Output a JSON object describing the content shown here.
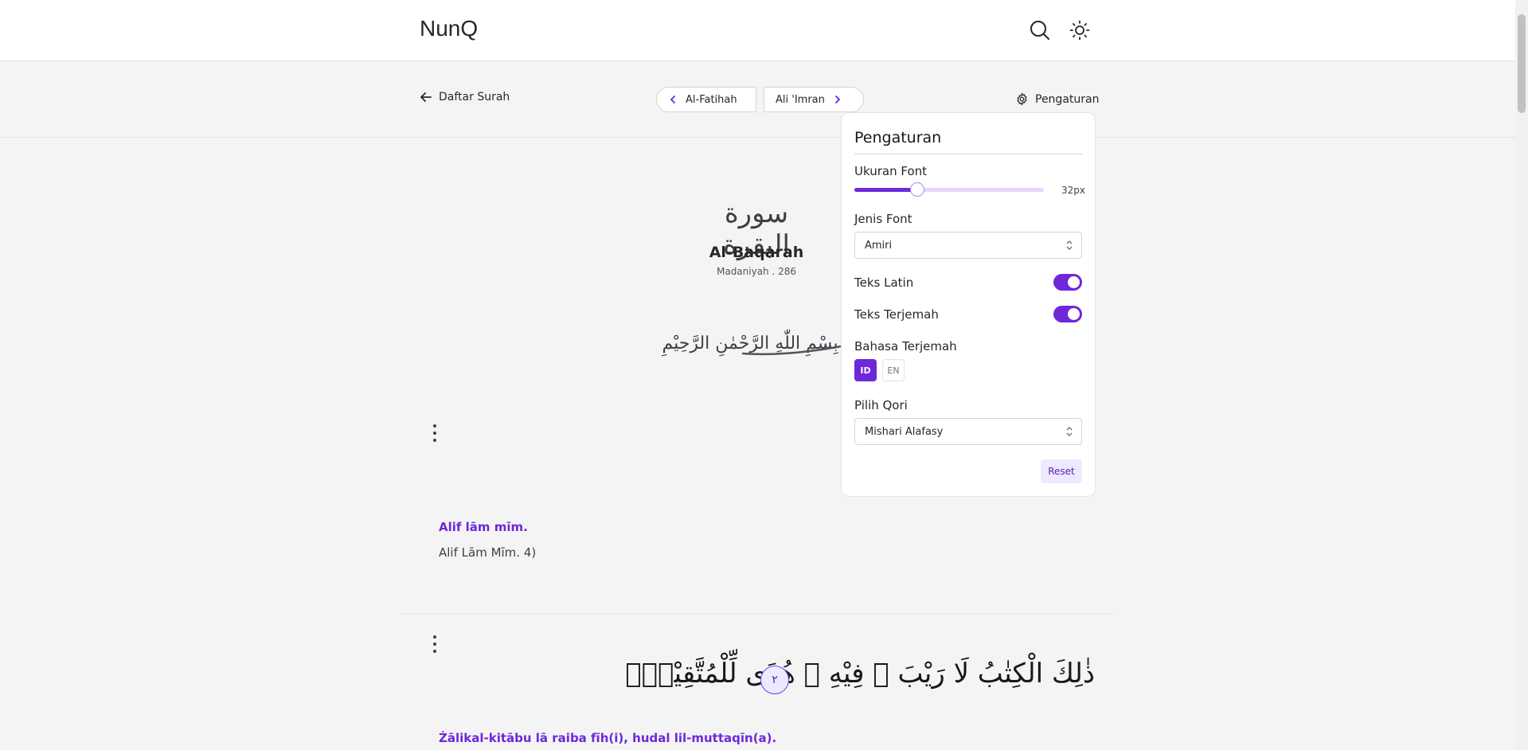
{
  "header": {
    "brand": "NunQ",
    "search_icon": "search-icon",
    "theme_icon": "sun-icon"
  },
  "subnav": {
    "back_label": "Daftar Surah",
    "prev_surah": "Al-Fatihah",
    "next_surah": "Ali 'Imran",
    "settings_label": "Pengaturan"
  },
  "surah": {
    "arabic_name": "سورة البقرة",
    "name": "Al-Baqarah",
    "meta": "Madaniyah . 286",
    "basmalah": "بِسْمِ اللّٰهِ الرَّحْمٰنِ الرَّحِيْمِ"
  },
  "verses": [
    {
      "latin": "Alif lām mīm.",
      "translation": "Alif Lām Mīm. 4)"
    },
    {
      "number_arabic": "٢",
      "arabic": "ذٰلِكَ الْكِتٰبُ لَا رَيْبَ ۛ فِيْهِ ۛ هُدًى لِّلْمُتَّقِيْنَۙ",
      "latin": "Żālikal-kitābu lā raiba fīh(i), hudal lil-muttaqīn(a)."
    }
  ],
  "settings": {
    "title": "Pengaturan",
    "font_size_label": "Ukuran Font",
    "font_size_value": "32px",
    "font_size_fraction": 0.33,
    "font_type_label": "Jenis Font",
    "font_type_value": "Amiri",
    "latin_label": "Teks Latin",
    "latin_on": true,
    "translation_label": "Teks Terjemah",
    "translation_on": true,
    "language_label": "Bahasa Terjemah",
    "languages": [
      "ID",
      "EN"
    ],
    "active_language": "ID",
    "qori_label": "Pilih Qori",
    "qori_value": "Mishari Alafasy",
    "reset_label": "Reset"
  },
  "colors": {
    "accent": "#6d28d9",
    "accent_light": "#ede9fe"
  }
}
